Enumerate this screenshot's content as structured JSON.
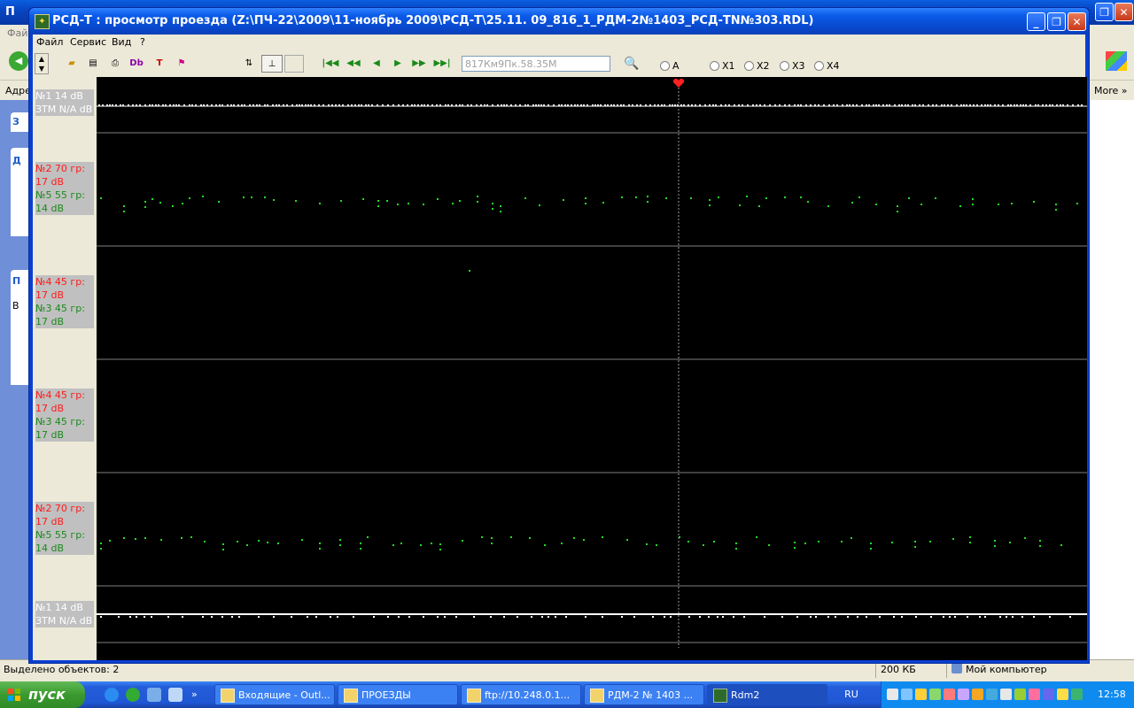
{
  "colors": {
    "plot_bg": "#000000",
    "green_signal": "#22dd22",
    "red_label": "#ff1a1a",
    "green_label": "#1a8a1a",
    "title_blue": "#0a5ae8"
  },
  "bg_window": {
    "title": "П",
    "menu_partial": "Фай",
    "address_partial": "Адре",
    "more": "More",
    "left_panel_chars": [
      "З",
      "Д",
      "П",
      "В"
    ],
    "status_left": "Выделено объектов: 2",
    "status_size": "200 КБ",
    "status_computer": "Мой компьютер"
  },
  "app": {
    "title": "РСД-Т : просмотр проезда (Z:\\ПЧ-22\\2009\\11-ноябрь 2009\\РСД-Т\\25.11. 09_816_1_РДМ-2№1403_РСД-ТN№303.RDL)",
    "menu": [
      "Файл",
      "Сервис",
      "Вид",
      "?"
    ],
    "toolbar": {
      "km_position": "817Км9Пк.58.35М",
      "radios": [
        "A",
        "X1",
        "X2",
        "X3",
        "X4"
      ],
      "nav_icons": [
        "skip-first-icon",
        "rewind-icon",
        "step-back-icon",
        "step-forward-icon",
        "fast-forward-icon",
        "skip-last-icon"
      ]
    },
    "channels": [
      {
        "lines": [
          {
            "text": "№1 14 dB",
            "color": "white"
          },
          {
            "text": "ЗТМ N/A dB",
            "color": "white"
          }
        ]
      },
      {
        "lines": [
          {
            "text": "№2 70 гр:",
            "color": "red"
          },
          {
            "text": "17 dB",
            "color": "red"
          },
          {
            "text": "№5 55 гр:",
            "color": "green"
          },
          {
            "text": "14 dB",
            "color": "green"
          }
        ]
      },
      {
        "lines": [
          {
            "text": "№4 45 гр:",
            "color": "red"
          },
          {
            "text": "17 dB",
            "color": "red"
          },
          {
            "text": "№3 45 гр:",
            "color": "green"
          },
          {
            "text": "17 dB",
            "color": "green"
          }
        ]
      },
      {
        "lines": [
          {
            "text": "№4 45 гр:",
            "color": "red"
          },
          {
            "text": "17 dB",
            "color": "red"
          },
          {
            "text": "№3 45 гр:",
            "color": "green"
          },
          {
            "text": "17 dB",
            "color": "green"
          }
        ]
      },
      {
        "lines": [
          {
            "text": "№2 70 гр:",
            "color": "red"
          },
          {
            "text": "17 dB",
            "color": "red"
          },
          {
            "text": "№5 55 гр:",
            "color": "green"
          },
          {
            "text": "14 dB",
            "color": "green"
          }
        ]
      },
      {
        "lines": [
          {
            "text": "№1 14 dB",
            "color": "white"
          },
          {
            "text": "ЗТМ N/A dB",
            "color": "white"
          }
        ]
      }
    ]
  },
  "taskbar": {
    "start": "пуск",
    "tasks": [
      {
        "label": "Входящие - Outl...",
        "active": false
      },
      {
        "label": "ПРОЕЗДЫ",
        "active": false
      },
      {
        "label": "ftp://10.248.0.1...",
        "active": false
      },
      {
        "label": "РДМ-2 № 1403 ...",
        "active": false
      },
      {
        "label": "Rdm2",
        "active": true
      }
    ],
    "lang": "RU",
    "clock": "12:58"
  }
}
